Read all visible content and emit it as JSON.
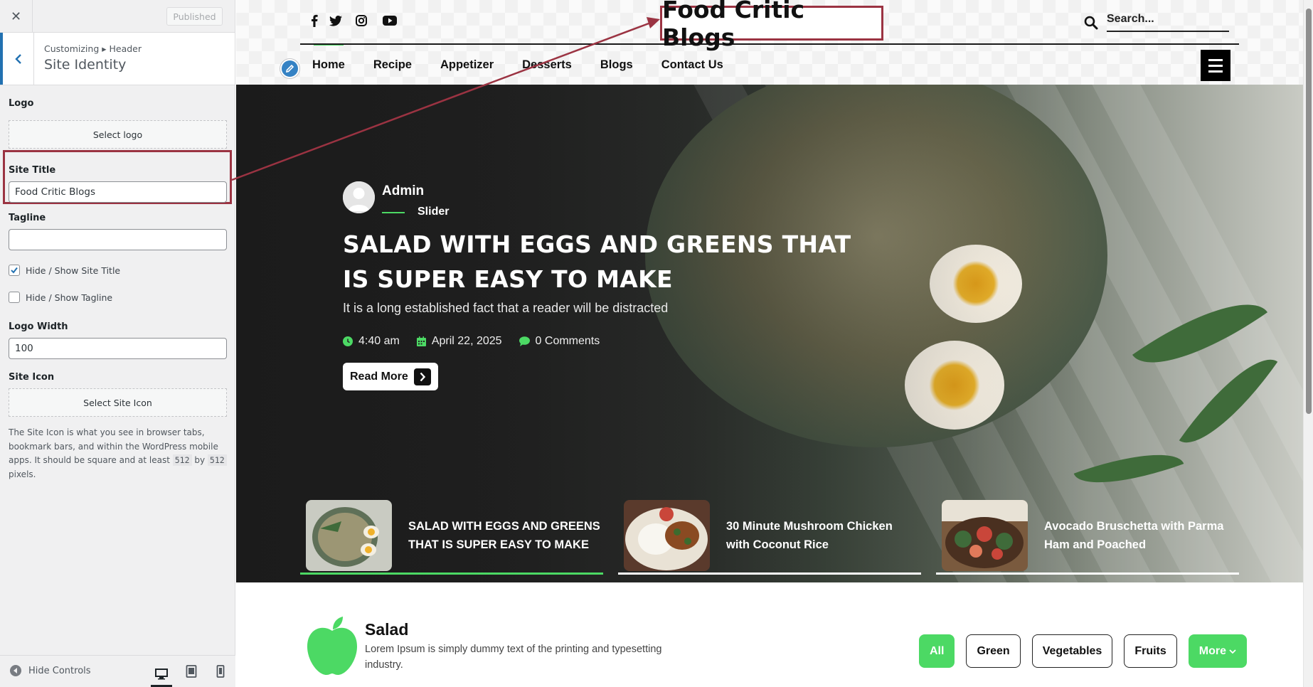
{
  "sidebar": {
    "close_icon": "close-icon",
    "published_label": "Published",
    "breadcrumb": "Customizing ▸ Header",
    "section_title": "Site Identity",
    "logo": {
      "label": "Logo",
      "button": "Select logo"
    },
    "site_title": {
      "label": "Site Title",
      "value": "Food Critic Blogs"
    },
    "tagline": {
      "label": "Tagline",
      "value": ""
    },
    "show_title": {
      "label": "Hide / Show Site Title",
      "checked": true
    },
    "show_tagline": {
      "label": "Hide / Show Tagline",
      "checked": false
    },
    "logo_width": {
      "label": "Logo Width",
      "value": "100"
    },
    "site_icon": {
      "label": "Site Icon",
      "button": "Select Site Icon",
      "help_pre": "The Site Icon is what you see in browser tabs, bookmark bars, and within the WordPress mobile apps. It should be square and at least",
      "code1": "512",
      "help_by": "by",
      "code2": "512",
      "help_post": "pixels."
    },
    "footer": {
      "hide_controls": "Hide Controls",
      "devices": [
        "desktop-icon",
        "tablet-icon",
        "mobile-icon"
      ]
    }
  },
  "preview": {
    "social_icons": [
      "facebook-icon",
      "twitter-icon",
      "instagram-icon",
      "youtube-icon"
    ],
    "site_title": "Food Critic Blogs",
    "search_placeholder": "Search...",
    "nav": [
      "Home",
      "Recipe",
      "Appetizer",
      "Desserts",
      "Blogs",
      "Contact Us"
    ],
    "hero": {
      "author": "Admin",
      "category": "Slider",
      "title": "SALAD WITH EGGS AND GREENS THAT IS SUPER EASY TO MAKE",
      "subtitle": "It is a long established fact that a reader will be distracted",
      "time": "4:40 am",
      "date": "April 22, 2025",
      "comments": "0 Comments",
      "read_more": "Read More"
    },
    "thumbs": [
      {
        "title": "SALAD WITH EGGS AND GREENS THAT IS SUPER EASY TO MAKE",
        "active": true
      },
      {
        "title": "30 Minute Mushroom Chicken with Coconut Rice",
        "active": false
      },
      {
        "title": "Avocado Bruschetta with Parma Ham and Poached",
        "active": false
      }
    ],
    "section": {
      "title": "Salad",
      "description": "Lorem Ipsum is simply dummy text of the printing and typesetting industry.",
      "filters": [
        "All",
        "Green",
        "Vegetables",
        "Fruits",
        "More"
      ]
    }
  },
  "colors": {
    "accent_green": "#4cd964",
    "wp_blue": "#2271b1",
    "highlight": "#9b3342"
  }
}
